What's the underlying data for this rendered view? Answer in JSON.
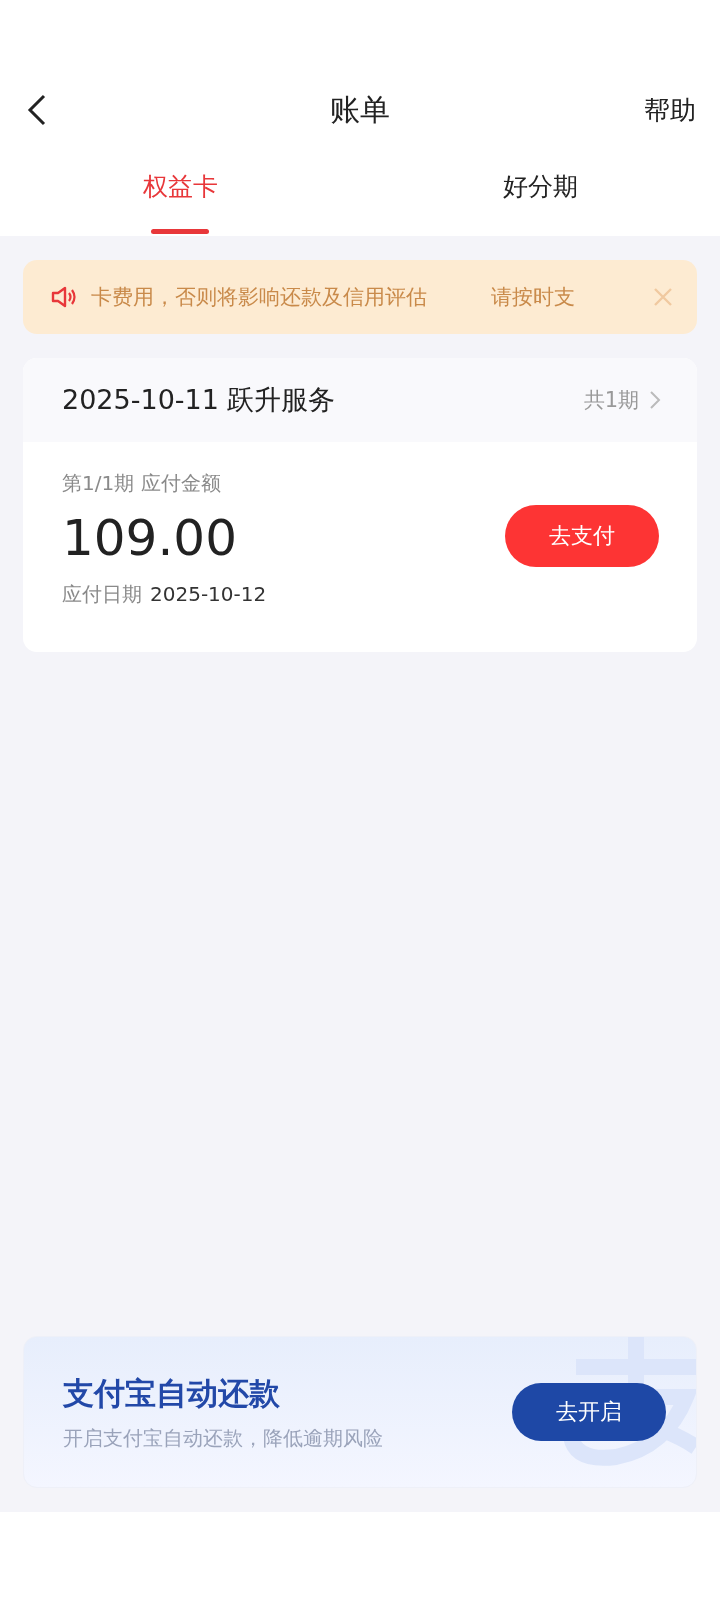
{
  "header": {
    "title": "账单",
    "help": "帮助"
  },
  "tabs": [
    {
      "label": "权益卡",
      "selected": true
    },
    {
      "label": "好分期",
      "selected": false
    }
  ],
  "notice": {
    "texts": [
      "卡费用，否则将影响还款及信用评估",
      "请按时支"
    ]
  },
  "bill": {
    "title": "2025-10-11 跃升服务",
    "periods": "共1期",
    "period_label": "第1/1期 应付金额",
    "amount": "109.00",
    "pay_button": "去支付",
    "due_label": "应付日期",
    "due_date": "2025-10-12"
  },
  "autopay": {
    "title": "支付宝自动还款",
    "subtitle": "开启支付宝自动还款，降低逾期风险",
    "button": "去开启"
  }
}
